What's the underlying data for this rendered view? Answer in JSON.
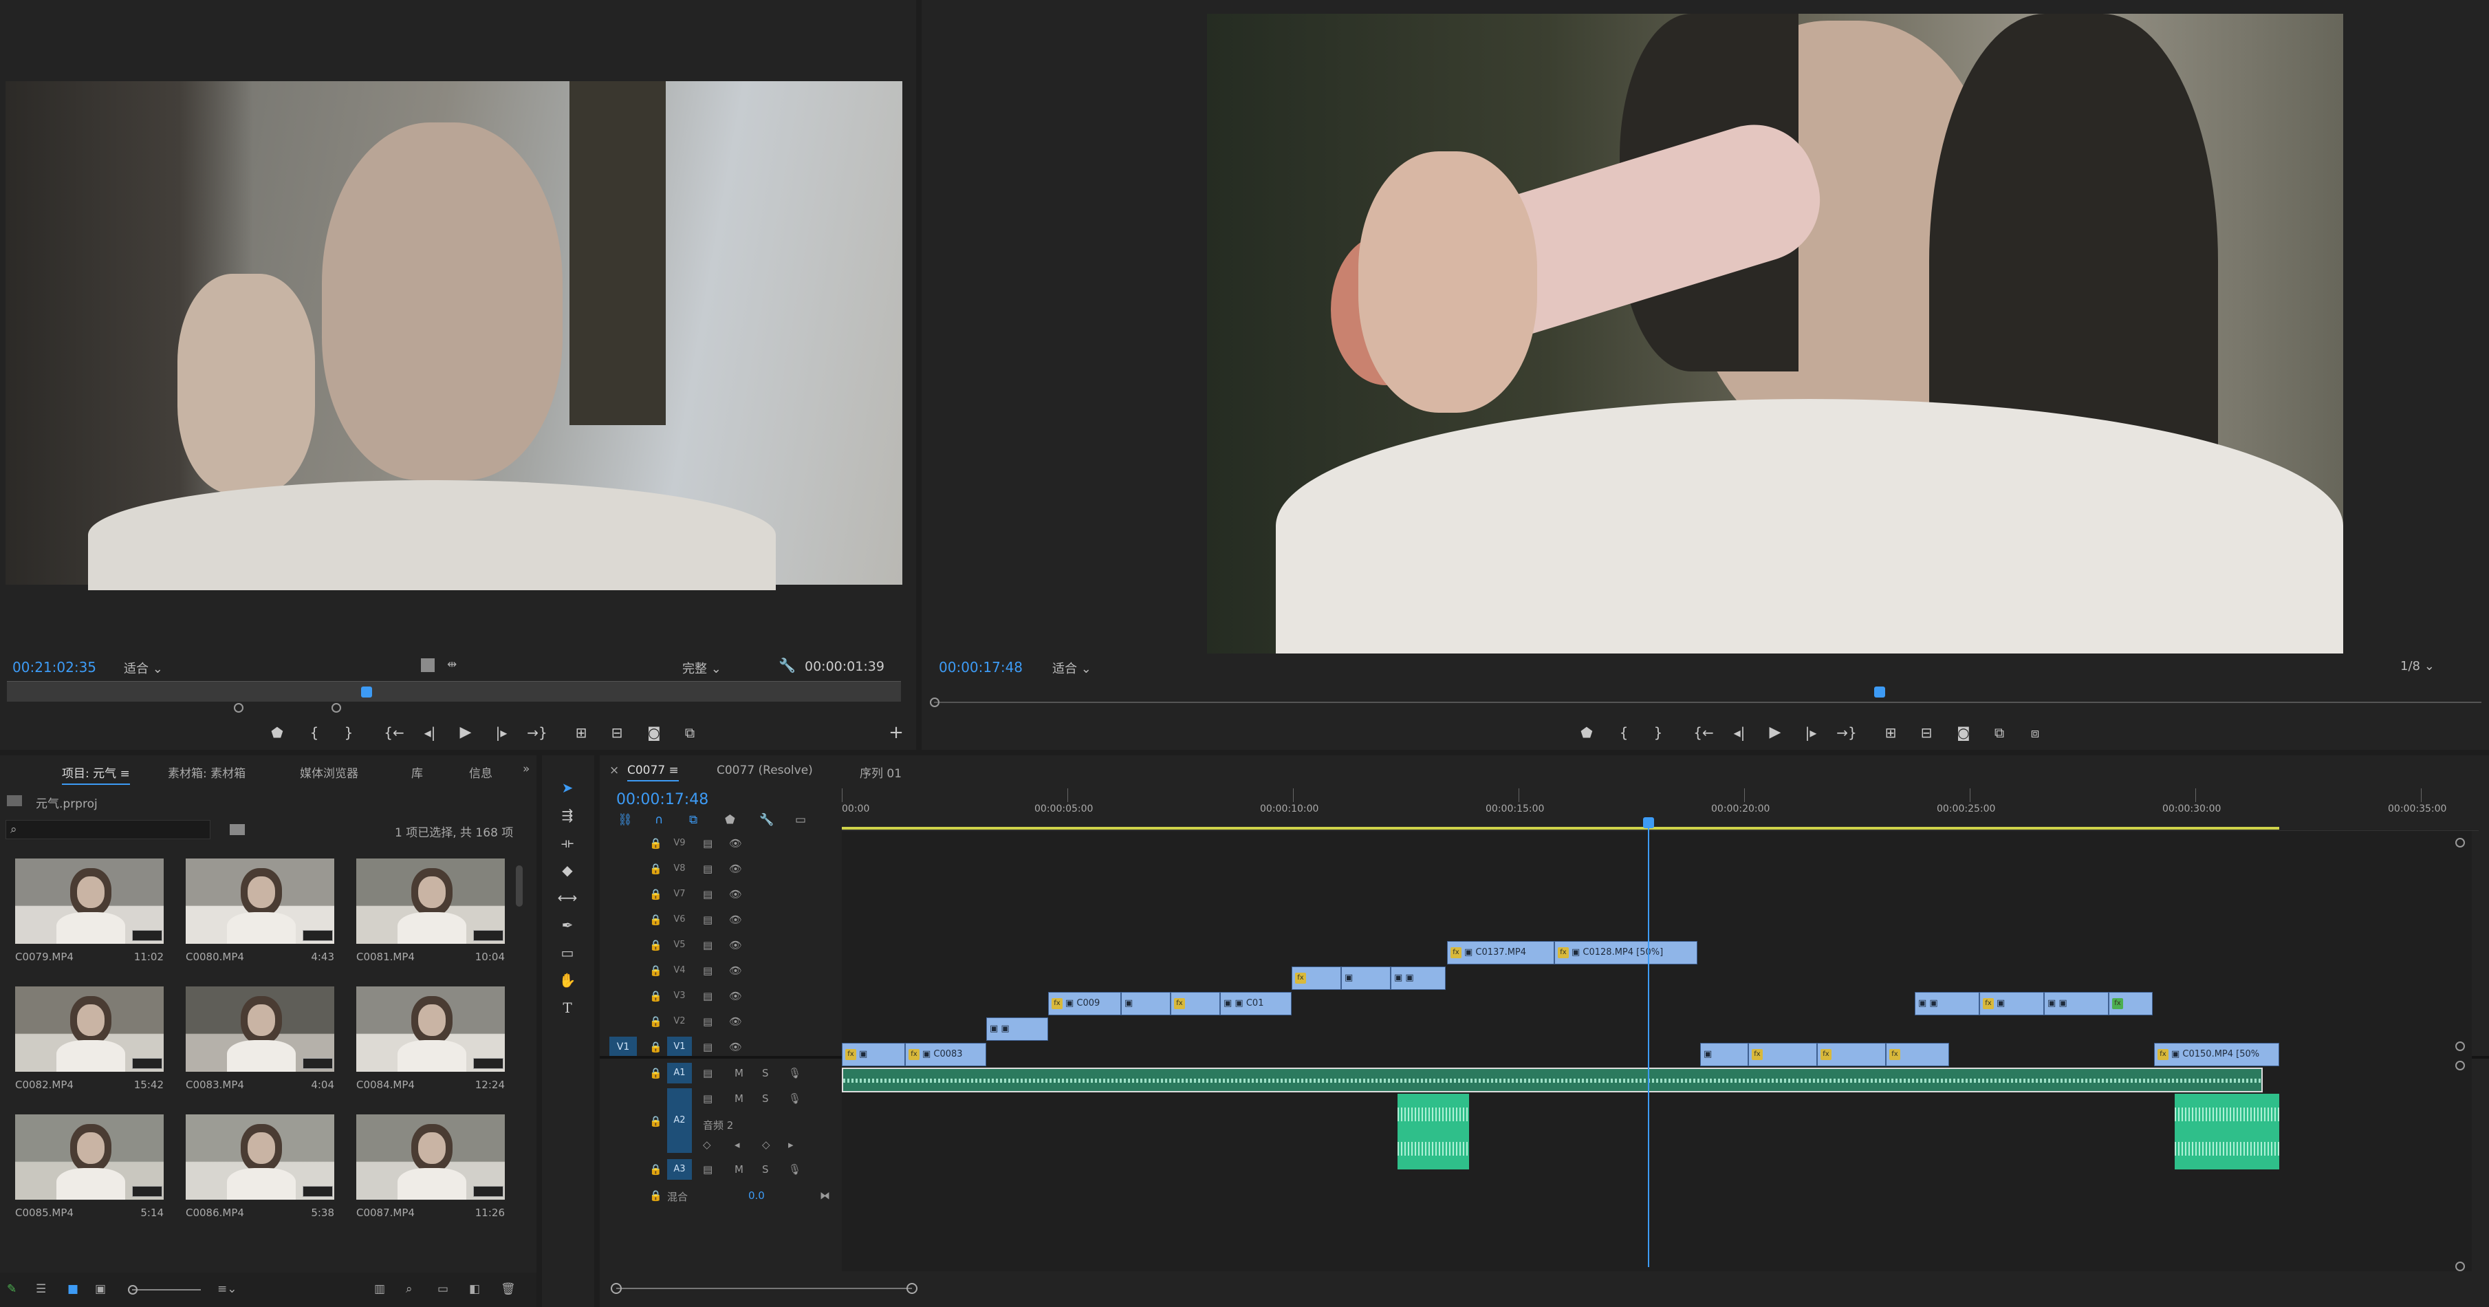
{
  "source_monitor": {
    "timecode": "00:21:02:35",
    "fit": "适合",
    "quality": "完整",
    "duration": "00:00:01:39"
  },
  "program_monitor": {
    "timecode": "00:00:17:48",
    "fit": "适合",
    "resolution": "1/8"
  },
  "project_panel": {
    "tabs": [
      "项目: 元气",
      "素材箱: 素材箱",
      "媒体浏览器",
      "库",
      "信息"
    ],
    "project_file": "元气.prproj",
    "selection_info": "1 项已选择, 共 168 项",
    "search_placeholder": "",
    "clips": [
      {
        "name": "C0079.MP4",
        "duration": "11:02"
      },
      {
        "name": "C0080.MP4",
        "duration": "4:43"
      },
      {
        "name": "C0081.MP4",
        "duration": "10:04"
      },
      {
        "name": "C0082.MP4",
        "duration": "15:42"
      },
      {
        "name": "C0083.MP4",
        "duration": "4:04"
      },
      {
        "name": "C0084.MP4",
        "duration": "12:24"
      },
      {
        "name": "C0085.MP4",
        "duration": "5:14"
      },
      {
        "name": "C0086.MP4",
        "duration": "5:38"
      },
      {
        "name": "C0087.MP4",
        "duration": "11:26"
      }
    ]
  },
  "timeline": {
    "tabs": [
      "C0077",
      "C0077 (Resolve)",
      "序列 01"
    ],
    "timecode": "00:00:17:48",
    "ruler": [
      "00:00",
      "00:00:05:00",
      "00:00:10:00",
      "00:00:15:00",
      "00:00:20:00",
      "00:00:25:00",
      "00:00:30:00",
      "00:00:35:00"
    ],
    "video_tracks": [
      "V9",
      "V8",
      "V7",
      "V6",
      "V5",
      "V4",
      "V3",
      "V2",
      "V1"
    ],
    "audio_tracks": [
      "A1",
      "A2",
      "A3"
    ],
    "audio_track_name": "音频 2",
    "mix_label": "混合",
    "mix_value": "0.0",
    "source_patch": "V1",
    "clips": {
      "v5_a": "C0137.MP4",
      "v5_b": "C0128.MP4 [50%]",
      "v3_a": "C009",
      "v3_b": "C01",
      "v1_a": "C0083",
      "v1_b": "C0150.MP4 [50%"
    },
    "track_buttons": {
      "mute": "M",
      "solo": "S"
    }
  },
  "colors": {
    "accent": "#3d9bf5",
    "clip_video": "#8fb5e8",
    "clip_audio": "#2fbf8a",
    "background": "#1d1d1d",
    "panel": "#232323"
  }
}
